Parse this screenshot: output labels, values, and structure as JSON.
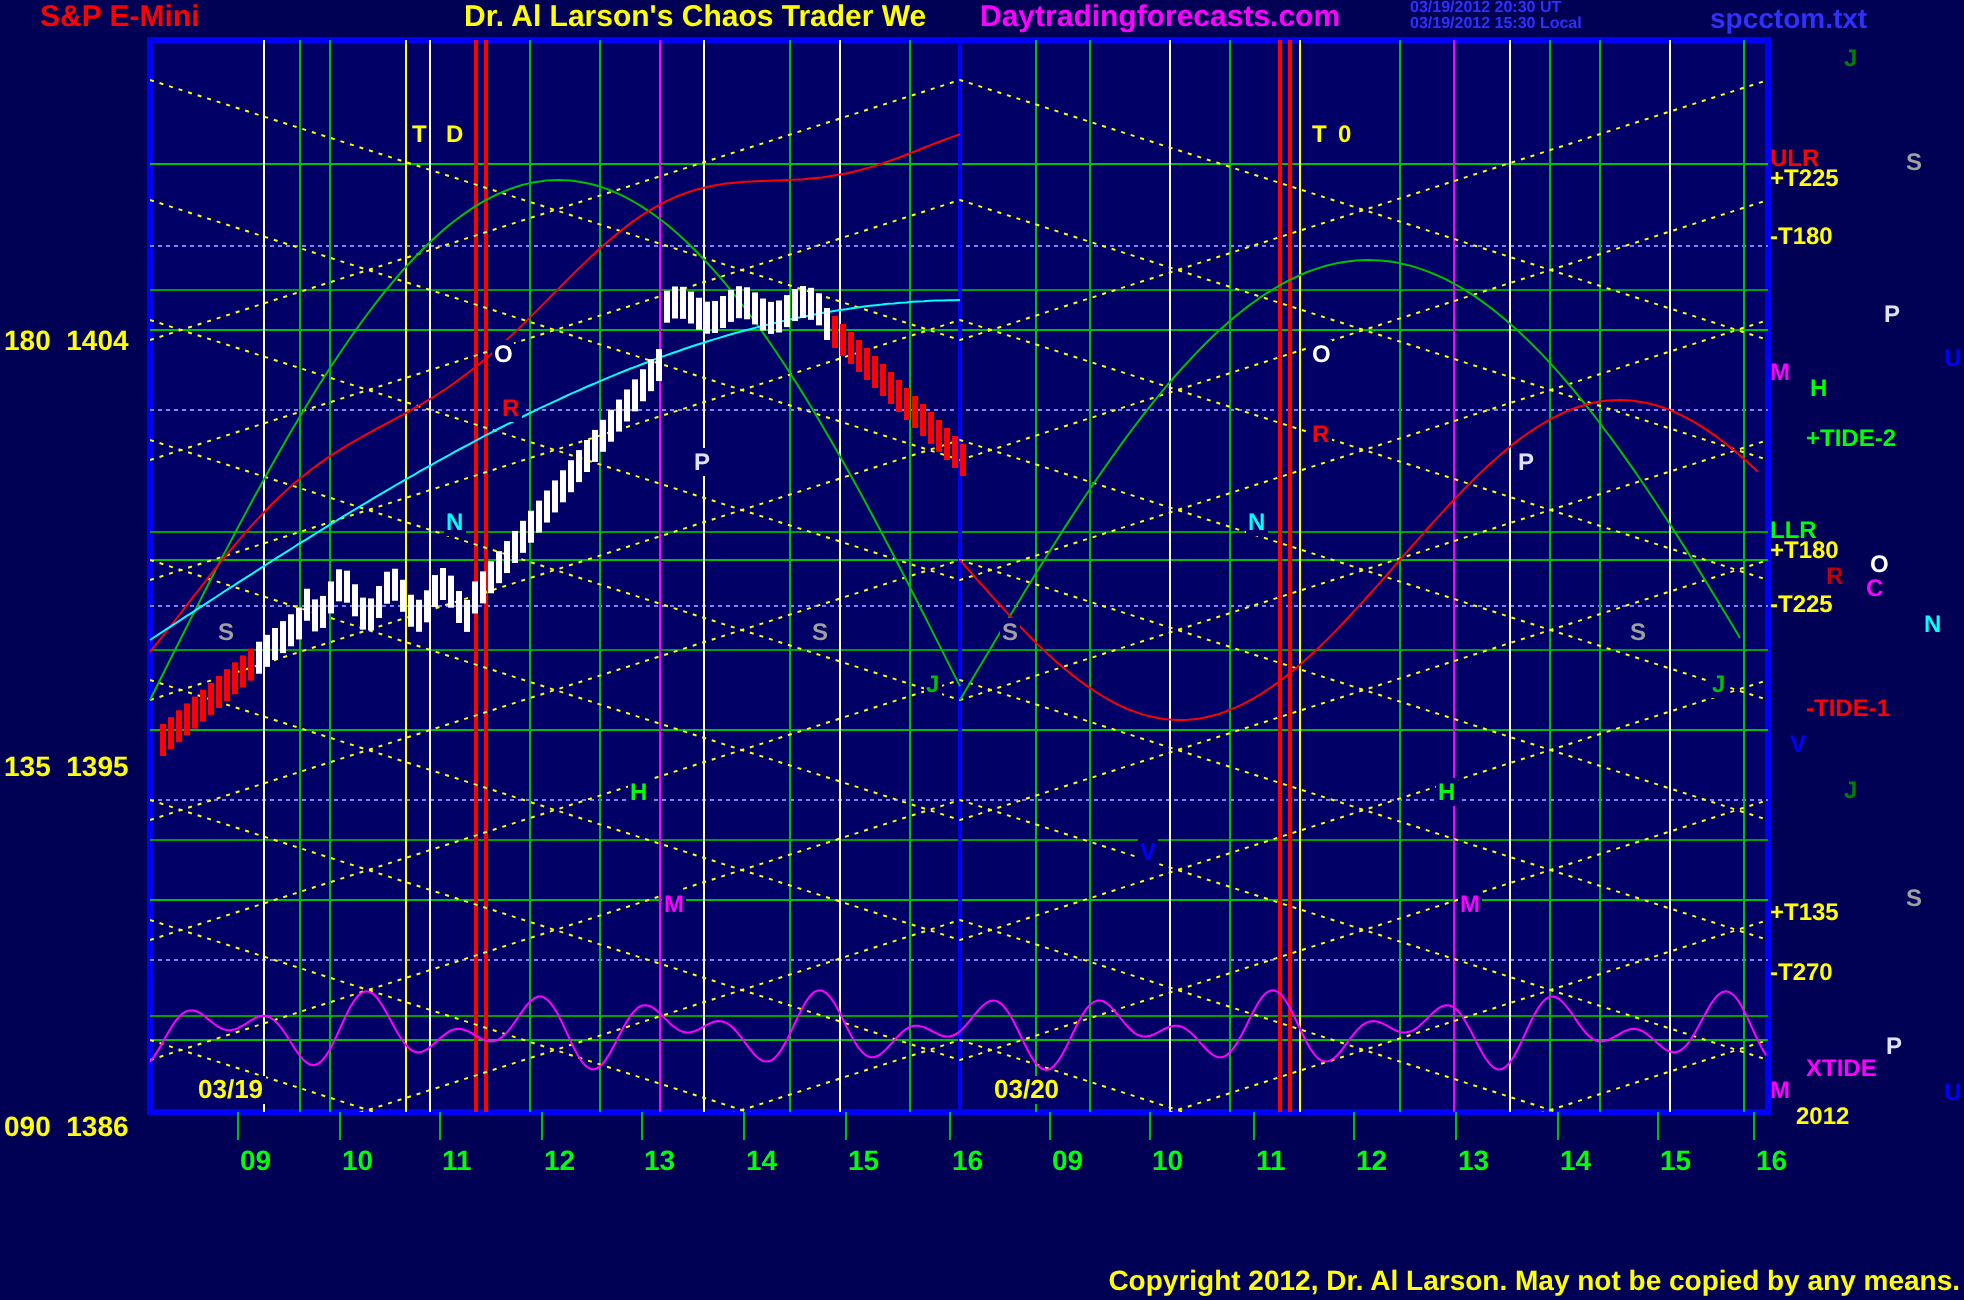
{
  "header": {
    "instrument": "S&P E-Mini",
    "title": "Dr. Al Larson's Chaos Trader We",
    "site": "Daytradingforecasts.com",
    "timestamp_ut": "03/19/2012 20:30 UT",
    "timestamp_local": "03/19/2012 15:30 Local",
    "file": "spcctom.txt"
  },
  "y_labels": [
    "180  1404",
    "135  1395",
    "090  1386"
  ],
  "x_labels": [
    "09",
    "10",
    "11",
    "12",
    "13",
    "14",
    "15",
    "16",
    "09",
    "10",
    "11",
    "12",
    "13",
    "14",
    "15",
    "16"
  ],
  "date_labels": [
    "03/19",
    "03/20"
  ],
  "chart_marks": [
    {
      "text": "T",
      "color": "#ffff00"
    },
    {
      "text": "D",
      "color": "#ffff00"
    },
    {
      "text": "T",
      "color": "#ffff00"
    },
    {
      "text": "0",
      "color": "#ffff00"
    },
    {
      "text": "O",
      "color": "#ffffff"
    },
    {
      "text": "O",
      "color": "#ffffff"
    },
    {
      "text": "R",
      "color": "#ff0000"
    },
    {
      "text": "R",
      "color": "#ff0000"
    },
    {
      "text": "P",
      "color": "#e0e0ff"
    },
    {
      "text": "P",
      "color": "#e0e0ff"
    },
    {
      "text": "N",
      "color": "#00ffff"
    },
    {
      "text": "N",
      "color": "#00ffff"
    },
    {
      "text": "S",
      "color": "#a0a0a0"
    },
    {
      "text": "S",
      "color": "#a0a0a0"
    },
    {
      "text": "S",
      "color": "#a0a0a0"
    },
    {
      "text": "S",
      "color": "#a0a0a0"
    },
    {
      "text": "J",
      "color": "#00c000"
    },
    {
      "text": "J",
      "color": "#00c000"
    },
    {
      "text": "H",
      "color": "#00ff00"
    },
    {
      "text": "H",
      "color": "#00ff00"
    },
    {
      "text": "V",
      "color": "#0000ff"
    },
    {
      "text": "M",
      "color": "#ff00ff"
    },
    {
      "text": "M",
      "color": "#ff00ff"
    }
  ],
  "right_marks": [
    {
      "text": "J",
      "color": "#008000"
    },
    {
      "text": "ULR",
      "color": "#ff0000"
    },
    {
      "text": "S",
      "color": "#a0a0a0"
    },
    {
      "text": "+T225",
      "color": "#ffff00"
    },
    {
      "text": "-T180",
      "color": "#ffff00"
    },
    {
      "text": "P",
      "color": "#e0e0ff"
    },
    {
      "text": "U",
      "color": "#0000ff"
    },
    {
      "text": "M",
      "color": "#ff00ff"
    },
    {
      "text": "H",
      "color": "#00ff00"
    },
    {
      "text": "+TIDE-2",
      "color": "#00ff00"
    },
    {
      "text": "LLR",
      "color": "#00ff00"
    },
    {
      "text": "+T180",
      "color": "#ffff00"
    },
    {
      "text": "O",
      "color": "#ffffff"
    },
    {
      "text": "R",
      "color": "#c00000"
    },
    {
      "text": "C",
      "color": "#ff00ff"
    },
    {
      "text": "-T225",
      "color": "#ffff00"
    },
    {
      "text": "N",
      "color": "#00ffff"
    },
    {
      "text": "-TIDE-1",
      "color": "#ff0000"
    },
    {
      "text": "V",
      "color": "#0000ff"
    },
    {
      "text": "J",
      "color": "#008000"
    },
    {
      "text": "S",
      "color": "#a0a0a0"
    },
    {
      "text": "+T135",
      "color": "#ffff00"
    },
    {
      "text": "-T270",
      "color": "#ffff00"
    },
    {
      "text": "P",
      "color": "#e0e0ff"
    },
    {
      "text": "XTIDE",
      "color": "#ff00ff"
    },
    {
      "text": "U",
      "color": "#0000ff"
    },
    {
      "text": "M",
      "color": "#ff00ff"
    },
    {
      "text": "2012",
      "color": "#ffff00"
    }
  ],
  "copyright": "Copyright 2012, Dr. Al Larson. May not be copied by any means."
}
